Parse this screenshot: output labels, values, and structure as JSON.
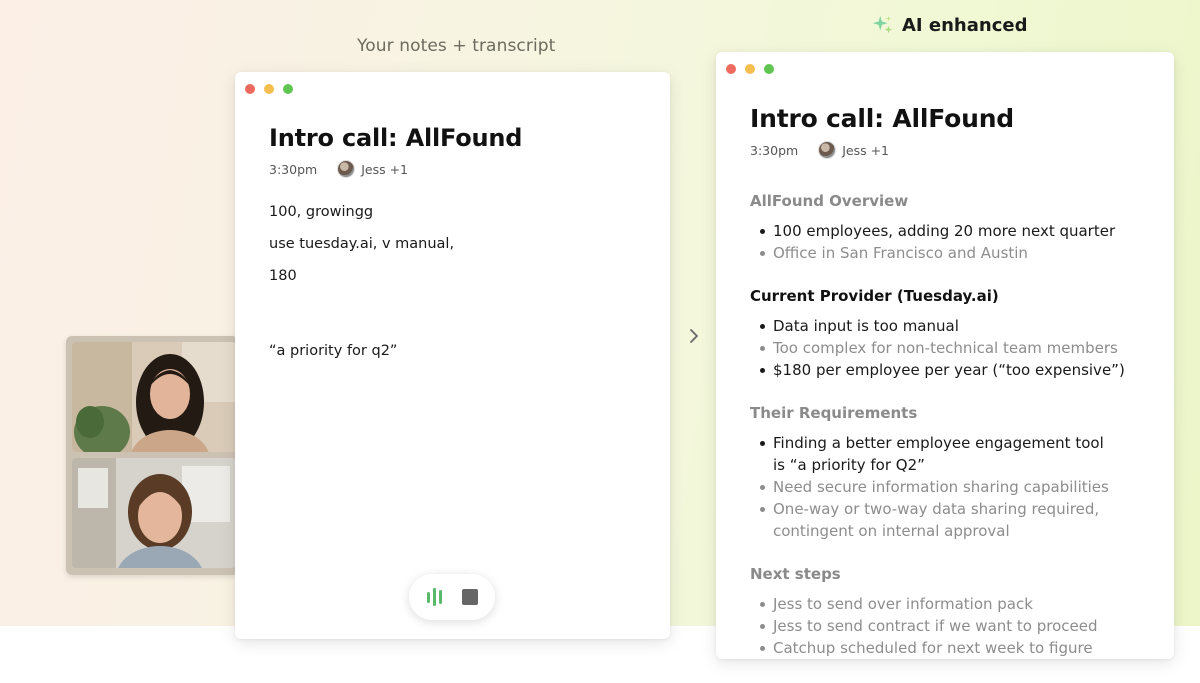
{
  "captions": {
    "left": "Your notes + transcript",
    "right": "AI enhanced"
  },
  "colors": {
    "accent_green": "#58b96a",
    "muted_text": "#8a8a8a"
  },
  "icons": {
    "sparkle": "sparkle-icon",
    "waveform": "audio-waveform-icon",
    "stop": "stop-icon",
    "arrow": "chevron-right-icon"
  },
  "notes_window": {
    "title": "Intro call: AllFound",
    "time": "3:30pm",
    "participants": "Jess +1",
    "lines": [
      "100, growingg",
      "use tuesday.ai, v manual,",
      "180",
      "“a priority for q2”"
    ]
  },
  "enhanced_window": {
    "title": "Intro call: AllFound",
    "time": "3:30pm",
    "participants": "Jess +1",
    "sections": [
      {
        "heading": "AllFound Overview",
        "bullets": [
          "100 employees, adding 20 more next quarter",
          "Office in San Francisco and Austin"
        ]
      },
      {
        "heading": "Current Provider (Tuesday.ai)",
        "bullets": [
          "Data input is too manual",
          "Too complex for non-technical team members",
          "$180 per employee per year (“too expensive”)"
        ]
      },
      {
        "heading": "Their Requirements",
        "bullets": [
          "Finding a better employee engagement tool is “a priority for Q2”",
          "Need secure information sharing capabilities",
          "One-way or two-way data sharing required, contingent on internal approval"
        ]
      },
      {
        "heading": "Next steps",
        "bullets": [
          "Jess to send over information pack",
          "Jess to send contract if we want to proceed",
          "Catchup scheduled for next week to figure"
        ]
      }
    ]
  }
}
